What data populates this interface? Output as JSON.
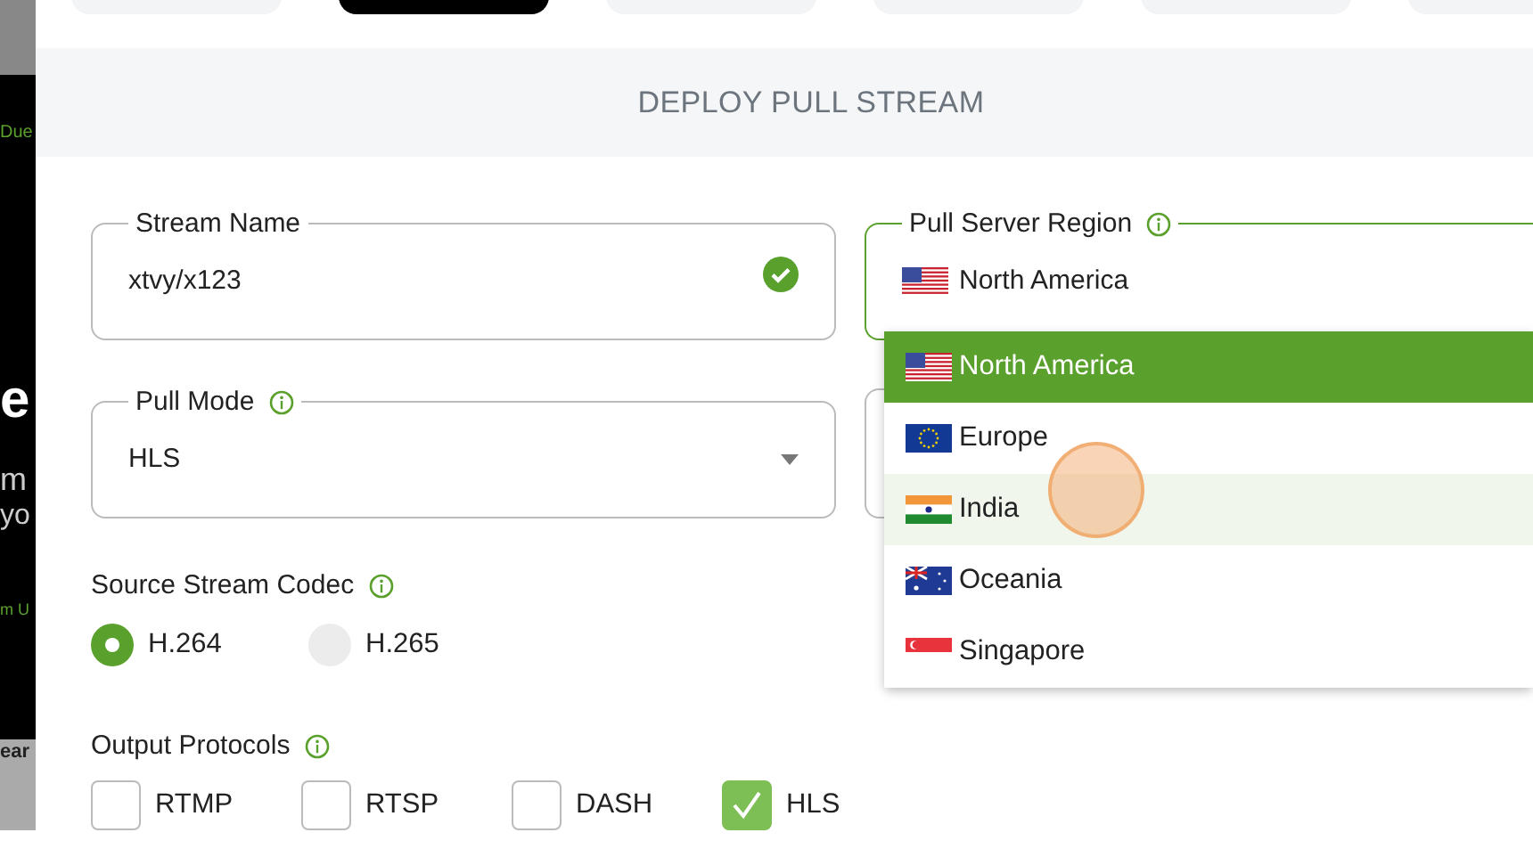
{
  "background_page": {
    "texts": [
      "Due",
      "e",
      "m",
      "yo",
      "m U",
      "ear"
    ]
  },
  "tabs": [
    {
      "selected": false
    },
    {
      "selected": true
    },
    {
      "selected": false
    },
    {
      "selected": false
    },
    {
      "selected": false
    },
    {
      "selected": false
    }
  ],
  "dialog": {
    "title": "DEPLOY PULL STREAM"
  },
  "stream_name": {
    "label": "Stream Name",
    "value": "xtvy/x123",
    "valid": true
  },
  "pull_server_region": {
    "label": "Pull Server Region",
    "value": "North America",
    "focused": true,
    "options": [
      {
        "label": "North America",
        "selected": true,
        "hovered": false
      },
      {
        "label": "Europe",
        "selected": false,
        "hovered": false
      },
      {
        "label": "India",
        "selected": false,
        "hovered": true
      },
      {
        "label": "Oceania",
        "selected": false,
        "hovered": false
      },
      {
        "label": "Singapore",
        "selected": false,
        "hovered": false
      }
    ]
  },
  "pull_mode": {
    "label": "Pull Mode",
    "value": "HLS"
  },
  "source_stream_codec": {
    "label": "Source Stream Codec",
    "options": [
      {
        "label": "H.264",
        "selected": true
      },
      {
        "label": "H.265",
        "selected": false
      }
    ]
  },
  "output_protocols": {
    "label": "Output Protocols",
    "options": [
      {
        "label": "RTMP",
        "checked": false
      },
      {
        "label": "RTSP",
        "checked": false
      },
      {
        "label": "DASH",
        "checked": false
      },
      {
        "label": "HLS",
        "checked": true
      }
    ]
  }
}
